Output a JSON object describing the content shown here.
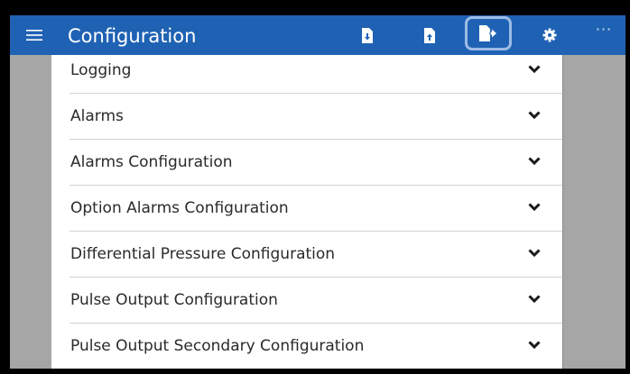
{
  "header": {
    "title": "Configuration",
    "background_color": "#1f62b4",
    "menu_icon": "hamburger-menu-icon",
    "actions": [
      {
        "icon": "file-download-icon",
        "highlighted": false
      },
      {
        "icon": "file-upload-icon",
        "highlighted": false
      },
      {
        "icon": "file-export-icon",
        "highlighted": true
      },
      {
        "icon": "gear-icon",
        "highlighted": false
      },
      {
        "icon": "more-options-icon",
        "label": "···",
        "highlighted": false
      }
    ]
  },
  "sections": [
    {
      "label": "Logging",
      "expand_icon": "chevron-down-icon"
    },
    {
      "label": "Alarms",
      "expand_icon": "chevron-down-icon"
    },
    {
      "label": "Alarms Configuration",
      "expand_icon": "chevron-down-icon"
    },
    {
      "label": "Option Alarms Configuration",
      "expand_icon": "chevron-down-icon"
    },
    {
      "label": "Differential Pressure Configuration",
      "expand_icon": "chevron-down-icon"
    },
    {
      "label": "Pulse Output Configuration",
      "expand_icon": "chevron-down-icon"
    },
    {
      "label": "Pulse Output Secondary Configuration",
      "expand_icon": "chevron-down-icon"
    }
  ]
}
